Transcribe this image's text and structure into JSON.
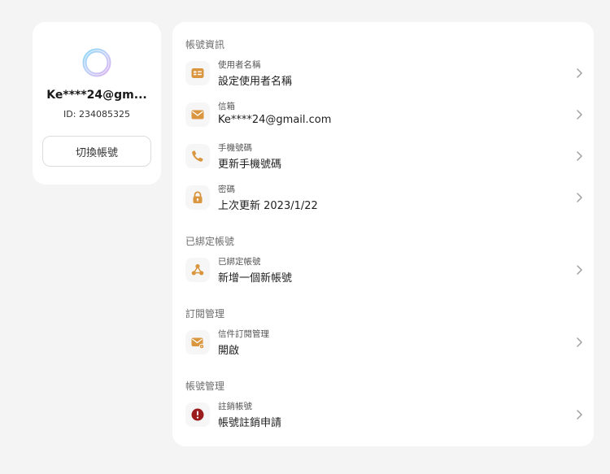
{
  "profile": {
    "email": "Ke****24@gm...",
    "id": "ID: 234085325",
    "switch_label": "切換帳號"
  },
  "sections": {
    "account_info": {
      "title": "帳號資訊",
      "items": [
        {
          "label": "使用者名稱",
          "value": "設定使用者名稱",
          "icon": "id-card-icon"
        },
        {
          "label": "信箱",
          "value": "Ke****24@gmail.com",
          "icon": "mail-icon"
        },
        {
          "label": "手機號碼",
          "value": "更新手機號碼",
          "icon": "phone-icon"
        },
        {
          "label": "密碼",
          "value": "上次更新 2023/1/22",
          "icon": "lock-icon"
        }
      ]
    },
    "linked": {
      "title": "已綁定帳號",
      "items": [
        {
          "label": "已綁定帳號",
          "value": "新增一個新帳號",
          "icon": "link-nodes-icon"
        }
      ]
    },
    "subscription": {
      "title": "訂閱管理",
      "items": [
        {
          "label": "信件訂閱管理",
          "value": "開啟",
          "icon": "mail-settings-icon"
        }
      ]
    },
    "management": {
      "title": "帳號管理",
      "items": [
        {
          "label": "註銷帳號",
          "value": "帳號註銷申請",
          "icon": "alert-icon"
        }
      ]
    }
  },
  "colors": {
    "accent": "#d9963f",
    "danger": "#9b1c1c",
    "avatar_ring_a": "#8fd0f2",
    "avatar_ring_b": "#c9b4f0"
  }
}
